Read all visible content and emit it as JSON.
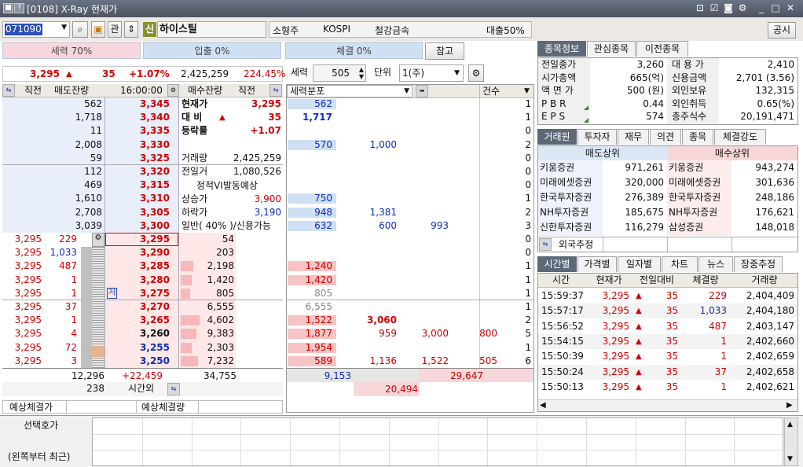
{
  "window": {
    "title": "[0108] X-Ray 현재가",
    "icons": [
      "help-icon",
      "doc-icon",
      "link-icon",
      "memo-icon",
      "camera-icon",
      "gear-icon"
    ],
    "min": "_",
    "max": "□",
    "close": "✕"
  },
  "toolbar": {
    "code": "071090",
    "btn_gwan": "관",
    "credit_badge": "신",
    "name": "하이스틸",
    "size": "소형주",
    "market": "KOSPI",
    "sector": "철강금속",
    "loan": "대출50%",
    "notice": "공시"
  },
  "bars": {
    "force": "세력 70%",
    "deposit": "입출 0%",
    "fill": "체결 0%",
    "ref": "참고"
  },
  "price_row": {
    "price": "3,295",
    "arrow": "▲",
    "change": "35",
    "rate": "+1.07%",
    "volume": "2,425,259",
    "turnover": "224.45%"
  },
  "ctrl": {
    "force_label": "세력",
    "force_val": "505",
    "unit_label": "단위",
    "unit_val": "1(주)"
  },
  "ob_header": {
    "recent": "직전",
    "ask_rem": "매도잔량",
    "time": "16:00:00",
    "bid_rem": "매수잔량",
    "recent2": "직전"
  },
  "asks": [
    {
      "rem": "562",
      "price": "3,345"
    },
    {
      "rem": "1,718",
      "price": "3,340"
    },
    {
      "rem": "11",
      "price": "3,335"
    },
    {
      "rem": "2,008",
      "price": "3,330"
    },
    {
      "rem": "59",
      "price": "3,325"
    },
    {
      "rem": "112",
      "price": "3,320"
    },
    {
      "rem": "469",
      "price": "3,315"
    },
    {
      "rem": "1,610",
      "price": "3,310"
    },
    {
      "rem": "2,708",
      "price": "3,305"
    },
    {
      "rem": "3,039",
      "price": "3,300"
    }
  ],
  "info": {
    "cur_label": "현재가",
    "cur_val": "3,295",
    "diff_label": "대 비",
    "diff_arrow": "▲",
    "diff_val": "35",
    "rate_label": "등락률",
    "rate_val": "+1.07",
    "vol_label": "거래량",
    "vol_val": "2,425,259",
    "prev_label": "전일거",
    "prev_val": "1,080,526",
    "vi_label": "정적VI발동예상",
    "upper_label": "상승가",
    "upper_val": "3,900",
    "lower_label": "하락가",
    "lower_val": "3,190",
    "general": "일반( 40% )/신용가능"
  },
  "bids": [
    {
      "recent": "3,295",
      "qty": "229",
      "price": "3,295",
      "rem": "54"
    },
    {
      "recent": "3,295",
      "qty": "1,033",
      "price": "3,290",
      "rem": "203"
    },
    {
      "recent": "3,295",
      "qty": "487",
      "price": "3,285",
      "rem": "2,198"
    },
    {
      "recent": "3,295",
      "qty": "1",
      "price": "3,280",
      "rem": "1,420"
    },
    {
      "recent": "3,295",
      "qty": "1",
      "price": "3,275",
      "rem": "805",
      "mark": "저"
    },
    {
      "recent": "3,295",
      "qty": "37",
      "price": "3,270",
      "rem": "6,555"
    },
    {
      "recent": "3,295",
      "qty": "1",
      "price": "3,265",
      "rem": "4,602"
    },
    {
      "recent": "3,295",
      "qty": "4",
      "price": "3,260",
      "rem": "9,383"
    },
    {
      "recent": "3,295",
      "qty": "72",
      "price": "3,255",
      "rem": "2,303"
    },
    {
      "recent": "3,295",
      "qty": "3",
      "price": "3,250",
      "rem": "7,232"
    }
  ],
  "ob_footer": {
    "ask_total": "12,296",
    "diff": "+22,459",
    "bid_total": "34,755",
    "after_hours": "238",
    "after_label": "시간외",
    "exp_price": "예상체결가",
    "exp_vol": "예상체결량"
  },
  "dist": {
    "header_label": "세력분포",
    "count_label": "건수",
    "ask_rows": [
      {
        "v": [
          "562"
        ],
        "count": "1"
      },
      {
        "v": [
          "1,717"
        ],
        "count": "1"
      },
      {
        "v": [],
        "count": "0"
      },
      {
        "v": [
          "570",
          "1,000"
        ],
        "count": "2"
      },
      {
        "v": [],
        "count": "0"
      },
      {
        "v": [],
        "count": "0"
      },
      {
        "v": [],
        "count": "0"
      },
      {
        "v": [
          "750"
        ],
        "count": "1"
      },
      {
        "v": [
          "948",
          "1,381"
        ],
        "count": "2"
      },
      {
        "v": [
          "632",
          "600",
          "993"
        ],
        "count": "3"
      }
    ],
    "bid_rows": [
      {
        "v": [],
        "count": "0"
      },
      {
        "v": [],
        "count": "0"
      },
      {
        "v": [
          "1,240"
        ],
        "count": "1"
      },
      {
        "v": [
          "1,420"
        ],
        "count": "1"
      },
      {
        "v": [
          "805"
        ],
        "count": "1"
      },
      {
        "v": [
          "6,555"
        ],
        "count": "1"
      },
      {
        "v": [
          "1,522",
          "3,060"
        ],
        "count": "2"
      },
      {
        "v": [
          "1,877",
          "959",
          "3,000",
          "800"
        ],
        "count": "5"
      },
      {
        "v": [
          "1,954"
        ],
        "count": "1"
      },
      {
        "v": [
          "589",
          "1,136",
          "1,522",
          "505"
        ],
        "count": "6"
      }
    ],
    "tot_ask": "9,153",
    "tot_bid": "29,647",
    "tot_all": "20,494"
  },
  "stock_tabs": [
    "종목정보",
    "관심종목",
    "이전종목"
  ],
  "stock_info": [
    {
      "l1": "전일종가",
      "v1": "3,260",
      "l2": "대 용 가",
      "v2": "2,410"
    },
    {
      "l1": "시가총액",
      "v1": "665(억)",
      "l2": "신용금액",
      "v2": "2,701  (3.56)"
    },
    {
      "l1": "액 면 가",
      "v1": "500 (원)",
      "l2": "외인보유",
      "v2": "132,315"
    },
    {
      "l1": "P B R",
      "v1": "0.44",
      "l2": "외인취득",
      "v2": "0.65(%)"
    },
    {
      "l1": "E P S",
      "v1": "574",
      "l2": "총주식수",
      "v2": "20,191,471"
    }
  ],
  "broker_tabs": [
    "거래원",
    "투자자",
    "재무",
    "의견",
    "종목",
    "체결강도"
  ],
  "brokers": {
    "sell_title": "매도상위",
    "buy_title": "매수상위",
    "rows": [
      {
        "s": "키움증권",
        "sv": "971,261",
        "b": "키움증권",
        "bv": "943,274"
      },
      {
        "s": "미래에셋증권",
        "sv": "320,000",
        "b": "미래에셋증권",
        "bv": "301,636"
      },
      {
        "s": "한국투자증권",
        "sv": "276,389",
        "b": "한국투자증권",
        "bv": "248,186"
      },
      {
        "s": "NH투자증권",
        "sv": "185,675",
        "b": "NH투자증권",
        "bv": "176,621"
      },
      {
        "s": "신한투자증권",
        "sv": "116,279",
        "b": "삼성증권",
        "bv": "148,018"
      }
    ],
    "foreign": "외국추정"
  },
  "time_tabs": [
    "시간별",
    "가격별",
    "일자별",
    "차트",
    "뉴스",
    "장중추정"
  ],
  "time_table": {
    "headers": [
      "시간",
      "현재가",
      "전일대비",
      "체결량",
      "거래량"
    ],
    "rows": [
      {
        "t": "15:59:37",
        "p": "3,295",
        "a": "▲",
        "d": "35",
        "q": "229",
        "v": "2,404,409"
      },
      {
        "t": "15:57:17",
        "p": "3,295",
        "a": "▲",
        "d": "35",
        "q": "1,033",
        "v": "2,404,180"
      },
      {
        "t": "15:56:52",
        "p": "3,295",
        "a": "▲",
        "d": "35",
        "q": "487",
        "v": "2,403,147"
      },
      {
        "t": "15:54:15",
        "p": "3,295",
        "a": "▲",
        "d": "35",
        "q": "1",
        "v": "2,402,660"
      },
      {
        "t": "15:50:39",
        "p": "3,295",
        "a": "▲",
        "d": "35",
        "q": "1",
        "v": "2,402,659"
      },
      {
        "t": "15:50:24",
        "p": "3,295",
        "a": "▲",
        "d": "35",
        "q": "37",
        "v": "2,402,658"
      },
      {
        "t": "15:50:13",
        "p": "3,295",
        "a": "▲",
        "d": "35",
        "q": "1",
        "v": "2,402,621"
      }
    ]
  },
  "bottom": {
    "label1": "선택호가",
    "label2": "(왼쪽부터 최근)"
  }
}
